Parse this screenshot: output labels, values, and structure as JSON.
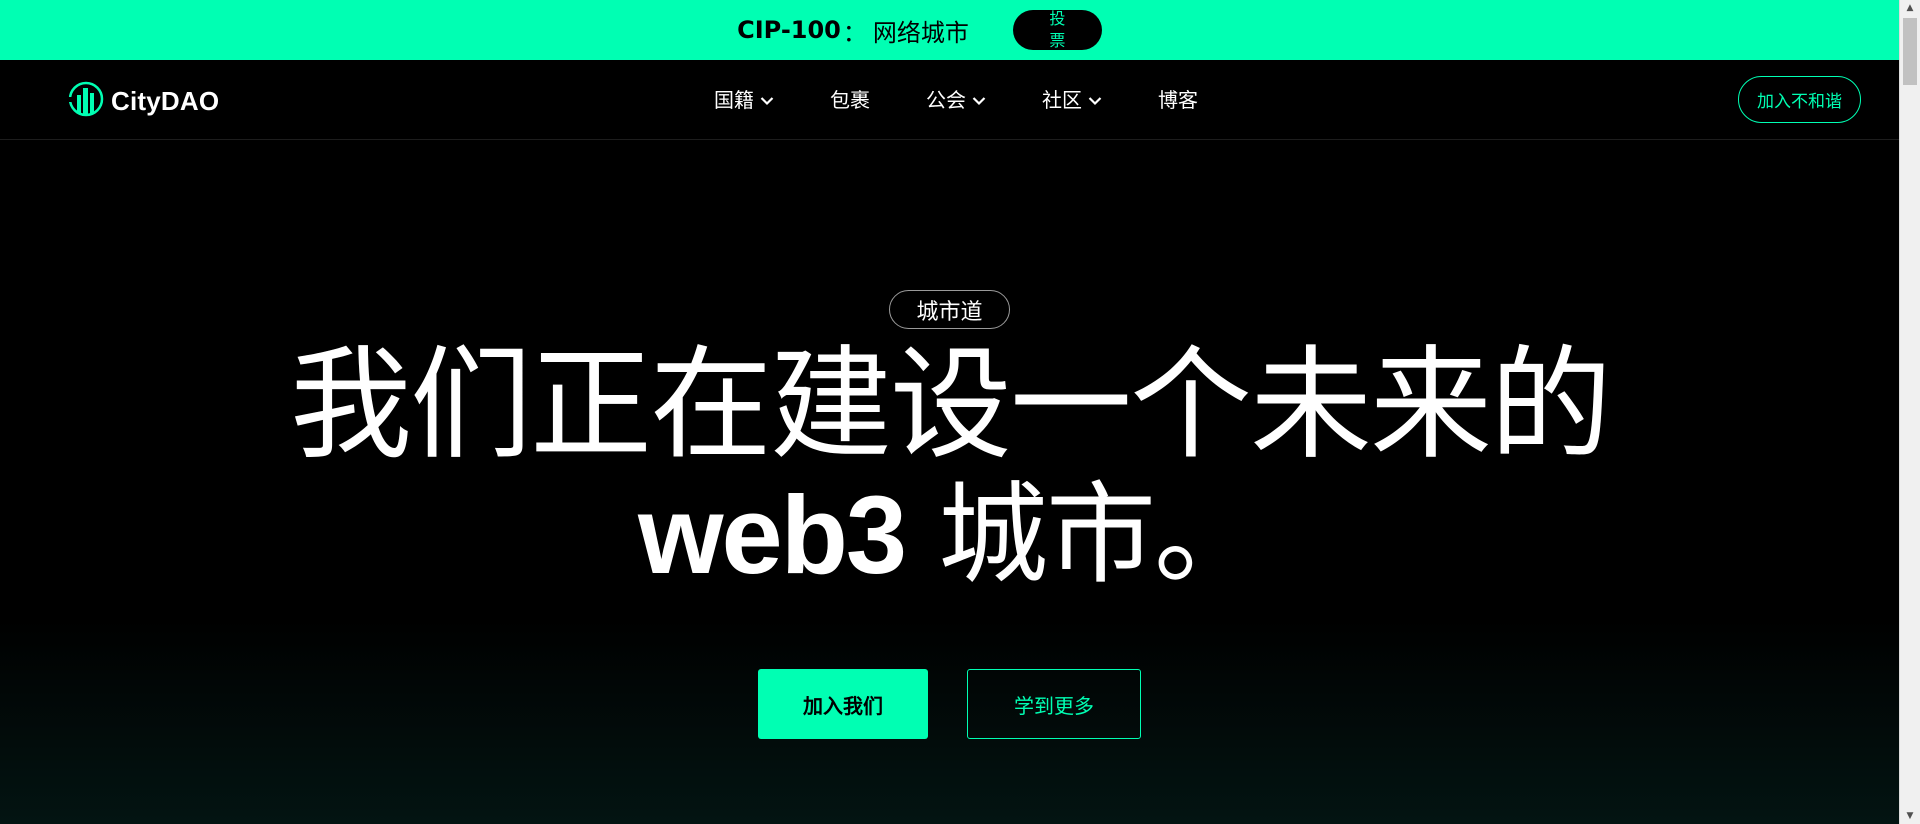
{
  "banner": {
    "proposal_code": "CIP-100",
    "separator": "：",
    "proposal_title": "网络城市",
    "vote_button_lines": [
      "投",
      "票"
    ],
    "background_color": "#00FFB3"
  },
  "navbar": {
    "logo_text": "CityDAO",
    "logo_icon": "citydao-logo-icon",
    "items": [
      {
        "label": "国籍",
        "has_dropdown": true
      },
      {
        "label": "包裹",
        "has_dropdown": false
      },
      {
        "label": "公会",
        "has_dropdown": true
      },
      {
        "label": "社区",
        "has_dropdown": true
      },
      {
        "label": "博客",
        "has_dropdown": false
      }
    ],
    "join_button": "加入不和谐"
  },
  "hero": {
    "badge": "城市道",
    "title_line1": "我们正在建设一个未来的",
    "title_line2_latin": "web3",
    "title_line2_rest": " 城市。",
    "primary_button": "加入我们",
    "secondary_button": "学到更多"
  },
  "theme": {
    "accent": "#00FFB3",
    "background": "#000000",
    "text": "#FFFFFF"
  }
}
